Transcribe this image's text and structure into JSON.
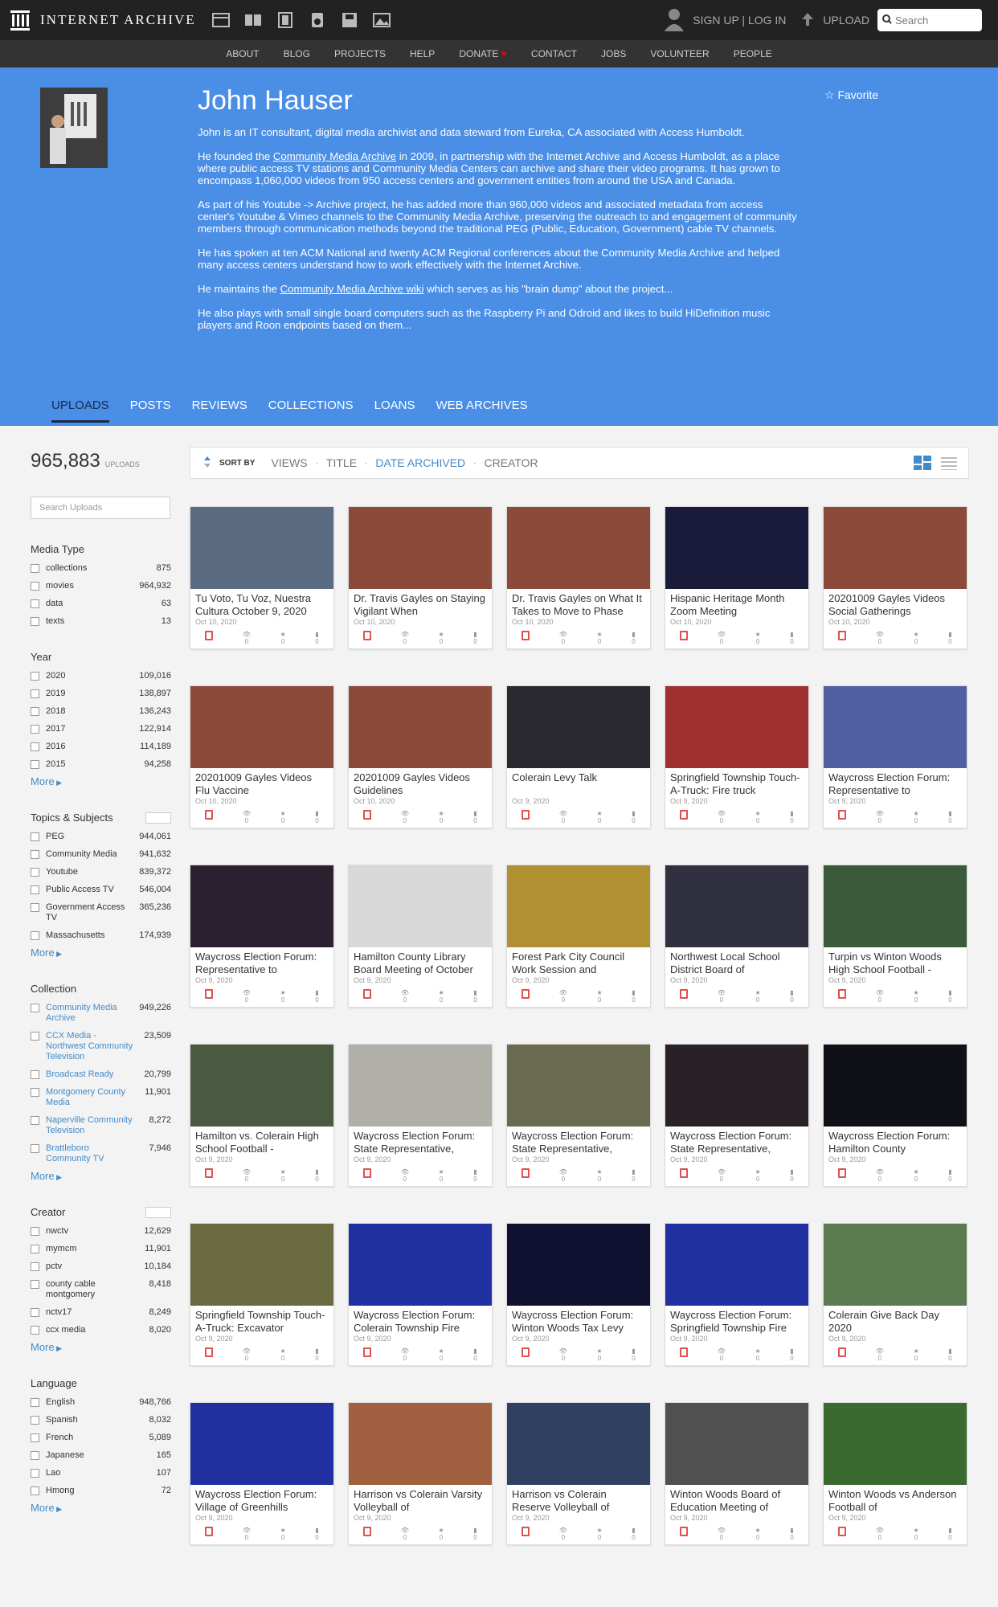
{
  "topbar": {
    "logo_text": "INTERNET ARCHIVE",
    "signin": "SIGN UP | LOG IN",
    "upload": "UPLOAD",
    "search_placeholder": "Search"
  },
  "nav": [
    "ABOUT",
    "BLOG",
    "PROJECTS",
    "HELP",
    "DONATE",
    "CONTACT",
    "JOBS",
    "VOLUNTEER",
    "PEOPLE"
  ],
  "profile": {
    "name": "John Hauser",
    "favorite": "Favorite",
    "bio1": "John is an IT consultant, digital media archivist and data steward from Eureka, CA associated with Access Humboldt.",
    "bio2a": "He founded the ",
    "bio2link": "Community Media Archive",
    "bio2b": " in 2009, in partnership with the Internet Archive and Access Humboldt, as a place where public access TV stations and Community Media Centers can archive and share their video programs. It has grown to encompass 1,060,000 videos from 950 access centers and government entities from around the USA and Canada.",
    "bio3": "As part of his Youtube -> Archive project, he has added more than 960,000 videos and associated metadata from access center's Youtube & Vimeo channels to the Community Media Archive, preserving the outreach to and engagement of community members through communication methods beyond the traditional PEG (Public, Education, Government) cable TV channels.",
    "bio4": "He has spoken at ten ACM National and twenty ACM Regional conferences about the Community Media Archive and helped many access centers understand how to work effectively with the Internet Archive.",
    "bio5a": "He maintains the ",
    "bio5link": "Community Media Archive wiki",
    "bio5b": " which serves as his \"brain dump\" about the project...",
    "bio6": "He also plays with small single board computers such as the Raspberry Pi and Odroid and likes to build HiDefinition music players and Roon endpoints based on them..."
  },
  "tabs": [
    "UPLOADS",
    "POSTS",
    "REVIEWS",
    "COLLECTIONS",
    "LOANS",
    "WEB ARCHIVES"
  ],
  "uploads": {
    "count": "965,883",
    "label": "UPLOADS",
    "search_placeholder": "Search Uploads"
  },
  "sort": {
    "label": "SORT BY",
    "options": [
      "VIEWS",
      "TITLE",
      "DATE ARCHIVED",
      "CREATOR"
    ],
    "active": "DATE ARCHIVED"
  },
  "facets": {
    "media_type": {
      "title": "Media Type",
      "rows": [
        [
          "collections",
          "875"
        ],
        [
          "movies",
          "964,932"
        ],
        [
          "data",
          "63"
        ],
        [
          "texts",
          "13"
        ]
      ]
    },
    "year": {
      "title": "Year",
      "rows": [
        [
          "2020",
          "109,016"
        ],
        [
          "2019",
          "138,897"
        ],
        [
          "2018",
          "136,243"
        ],
        [
          "2017",
          "122,914"
        ],
        [
          "2016",
          "114,189"
        ],
        [
          "2015",
          "94,258"
        ]
      ],
      "more": "More"
    },
    "topics": {
      "title": "Topics & Subjects",
      "rows": [
        [
          "PEG",
          "944,061"
        ],
        [
          "Community Media",
          "941,632"
        ],
        [
          "Youtube",
          "839,372"
        ],
        [
          "Public Access TV",
          "546,004"
        ],
        [
          "Government Access TV",
          "365,236"
        ],
        [
          "Massachusetts",
          "174,939"
        ]
      ],
      "more": "More"
    },
    "collection": {
      "title": "Collection",
      "rows": [
        [
          "Community Media Archive",
          "949,226"
        ],
        [
          "CCX Media - Northwest Community Television",
          "23,509"
        ],
        [
          "Broadcast Ready",
          "20,799"
        ],
        [
          "Montgomery County Media",
          "11,901"
        ],
        [
          "Naperville Community Television",
          "8,272"
        ],
        [
          "Brattleboro Community TV",
          "7,946"
        ]
      ],
      "more": "More"
    },
    "creator": {
      "title": "Creator",
      "rows": [
        [
          "nwctv",
          "12,629"
        ],
        [
          "mymcm",
          "11,901"
        ],
        [
          "pctv",
          "10,184"
        ],
        [
          "county cable montgomery",
          "8,418"
        ],
        [
          "nctv17",
          "8,249"
        ],
        [
          "ccx media",
          "8,020"
        ]
      ],
      "more": "More"
    },
    "language": {
      "title": "Language",
      "rows": [
        [
          "English",
          "948,766"
        ],
        [
          "Spanish",
          "8,032"
        ],
        [
          "French",
          "5,089"
        ],
        [
          "Japanese",
          "165"
        ],
        [
          "Lao",
          "107"
        ],
        [
          "Hmong",
          "72"
        ]
      ],
      "more": "More"
    }
  },
  "items": [
    {
      "title": "Tu Voto, Tu Voz, Nuestra Cultura October 9, 2020",
      "date": "Oct 10, 2020",
      "color": "#5a6a80"
    },
    {
      "title": "Dr. Travis Gayles on Staying Vigilant When",
      "date": "Oct 10, 2020",
      "color": "#8b4a3a"
    },
    {
      "title": "Dr. Travis Gayles on What It Takes to Move to Phase",
      "date": "Oct 10, 2020",
      "color": "#8b4a3a"
    },
    {
      "title": "Hispanic Heritage Month Zoom Meeting",
      "date": "Oct 10, 2020",
      "color": "#1a1a3a"
    },
    {
      "title": "20201009 Gayles Videos Social Gatherings",
      "date": "Oct 10, 2020",
      "color": "#8b4a3a"
    },
    {
      "title": "20201009 Gayles Videos Flu Vaccine",
      "date": "Oct 10, 2020",
      "color": "#8b4a3a"
    },
    {
      "title": "20201009 Gayles Videos Guidelines",
      "date": "Oct 10, 2020",
      "color": "#8b4a3a"
    },
    {
      "title": "Colerain Levy Talk",
      "date": "Oct 9, 2020",
      "color": "#2a2a30"
    },
    {
      "title": "Springfield Township Touch-A-Truck: Fire truck",
      "date": "Oct 9, 2020",
      "color": "#a03030"
    },
    {
      "title": "Waycross Election Forum: Representative to",
      "date": "Oct 9, 2020",
      "color": "#5060a0"
    },
    {
      "title": "Waycross Election Forum: Representative to",
      "date": "Oct 9, 2020",
      "color": "#2a2030"
    },
    {
      "title": "Hamilton County Library Board Meeting of October",
      "date": "Oct 9, 2020",
      "color": "#d8d8d8"
    },
    {
      "title": "Forest Park City Council Work Session and",
      "date": "Oct 9, 2020",
      "color": "#b09030"
    },
    {
      "title": "Northwest Local School District Board of",
      "date": "Oct 9, 2020",
      "color": "#303040"
    },
    {
      "title": "Turpin vs Winton Woods High School Football -",
      "date": "Oct 9, 2020",
      "color": "#3a5a3a"
    },
    {
      "title": "Hamilton vs. Colerain High School Football -",
      "date": "Oct 9, 2020",
      "color": "#4a5a40"
    },
    {
      "title": "Waycross Election Forum: State Representative,",
      "date": "Oct 9, 2020",
      "color": "#b0b0a8"
    },
    {
      "title": "Waycross Election Forum: State Representative,",
      "date": "Oct 9, 2020",
      "color": "#6a6a50"
    },
    {
      "title": "Waycross Election Forum: State Representative,",
      "date": "Oct 9, 2020",
      "color": "#2a2028"
    },
    {
      "title": "Waycross Election Forum: Hamilton County",
      "date": "Oct 9, 2020",
      "color": "#101018"
    },
    {
      "title": "Springfield Township Touch-A-Truck: Excavator",
      "date": "Oct 9, 2020",
      "color": "#6a6a40"
    },
    {
      "title": "Waycross Election Forum: Colerain Township Fire",
      "date": "Oct 9, 2020",
      "color": "#2030a0"
    },
    {
      "title": "Waycross Election Forum: Winton Woods Tax Levy",
      "date": "Oct 9, 2020",
      "color": "#101030"
    },
    {
      "title": "Waycross Election Forum: Springfield Township Fire",
      "date": "Oct 9, 2020",
      "color": "#2030a0"
    },
    {
      "title": "Colerain Give Back Day 2020",
      "date": "Oct 9, 2020",
      "color": "#5a7a50"
    },
    {
      "title": "Waycross Election Forum: Village of Greenhills",
      "date": "Oct 9, 2020",
      "color": "#2030a0"
    },
    {
      "title": "Harrison vs Colerain Varsity Volleyball of",
      "date": "Oct 9, 2020",
      "color": "#a06040"
    },
    {
      "title": "Harrison vs Colerain Reserve Volleyball of",
      "date": "Oct 9, 2020",
      "color": "#304060"
    },
    {
      "title": "Winton Woods Board of Education Meeting of",
      "date": "Oct 9, 2020",
      "color": "#505050"
    },
    {
      "title": "Winton Woods vs Anderson Football of",
      "date": "Oct 9, 2020",
      "color": "#3a6a30"
    }
  ]
}
